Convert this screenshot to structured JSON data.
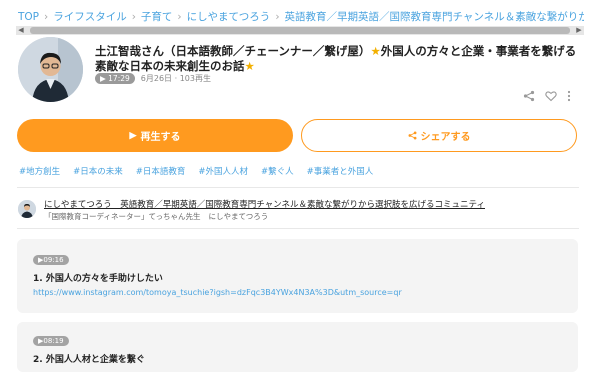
{
  "breadcrumb": {
    "items": [
      "TOP",
      "ライフスタイル",
      "子育て",
      "にしやまてつろう",
      "英語教育／早期英語／国際教育専門チャンネル＆素敵な繋がりから選択肢を"
    ],
    "separator": "›"
  },
  "episode": {
    "title_part1": "土江智哉さん（日本語教師／チェーンナー／繋げ屋）",
    "title_part2": "外国人の方々と企業・事業者を繋げる素敵な日本の未来創生のお話",
    "star_glyph": "★",
    "duration": "17:29",
    "date": "6月26日",
    "plays": "103再生"
  },
  "actions": {
    "play_label": "再生する",
    "share_label": "シェアする",
    "play_icon": "▶",
    "share_icon": "share-icon"
  },
  "tags": [
    "#地方創生",
    "#日本の未来",
    "#日本語教育",
    "#外国人人材",
    "#繋ぐ人",
    "#事業者と外国人"
  ],
  "channel": {
    "name": "にしやまてつろう　英語教育／早期英語／国際教育専門チャンネル＆素敵な繋がりから選択肢を広げるコミュニティ",
    "sub_role": "「国際教育コーディネーター」てっちゃん先生",
    "sub_name": "にしやまてつろう"
  },
  "chapters": [
    {
      "time": "09:16",
      "title": "1. 外国人の方々を手助けしたい",
      "link": "https://www.instagram.com/tomoya_tsuchie?igsh=dzFqc3B4YWx4N3A%3D&utm_source=qr"
    },
    {
      "time": "08:19",
      "title": "2. 外国人人材と企業を繋ぐ"
    }
  ],
  "colors": {
    "accent": "#ff9a1f",
    "link": "#4aa3df"
  }
}
